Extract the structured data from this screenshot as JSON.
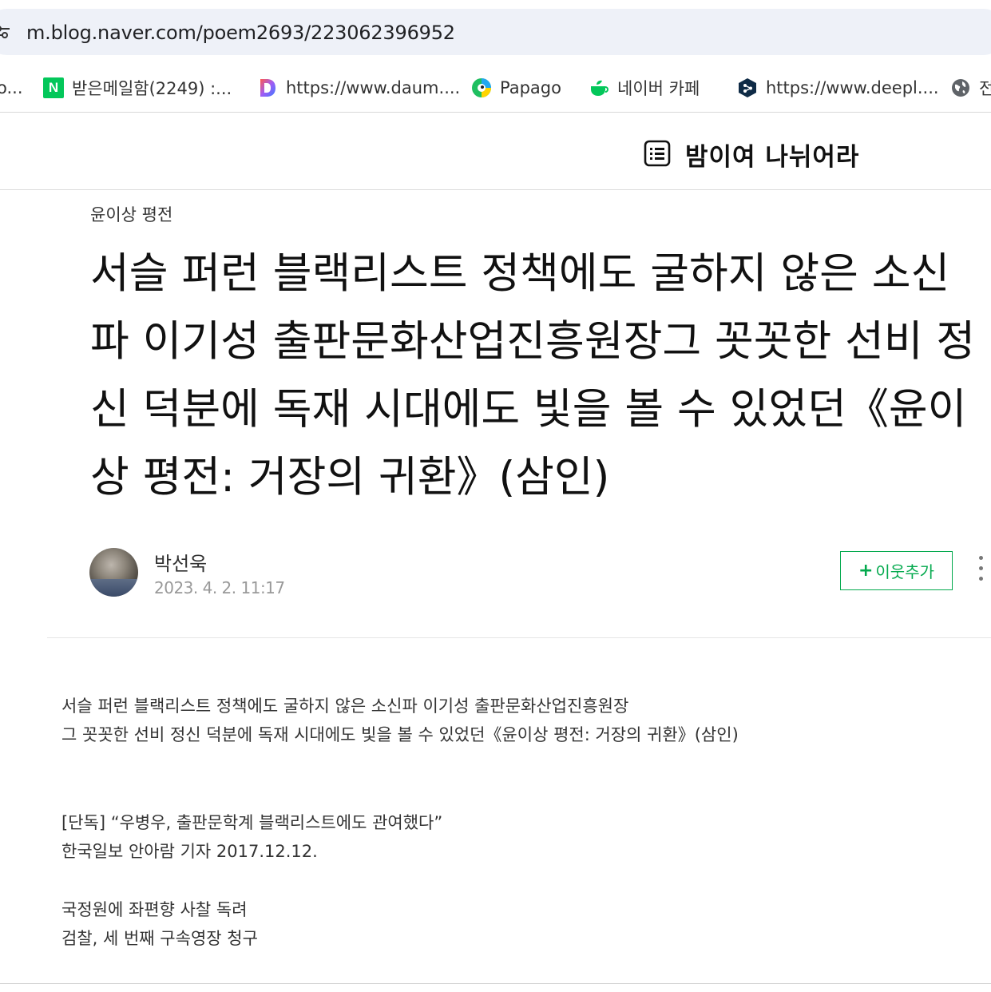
{
  "browser": {
    "url": "m.blog.naver.com/poem2693/223062396952",
    "bookmarks": [
      {
        "label": "o...",
        "icon": "unknown-icon"
      },
      {
        "label": "받은메일함(2249) :...",
        "icon": "naver-icon"
      },
      {
        "label": "https://www.daum....",
        "icon": "daum-icon"
      },
      {
        "label": "Papago",
        "icon": "papago-icon"
      },
      {
        "label": "네이버 카페",
        "icon": "naver-cafe-icon"
      },
      {
        "label": "https://www.deepl....",
        "icon": "deepl-icon"
      },
      {
        "label": "전",
        "icon": "globe-icon"
      }
    ]
  },
  "blog": {
    "title": "밤이여 나뉘어라"
  },
  "post": {
    "category": "윤이상 평전",
    "title": "서슬 퍼런 블랙리스트 정책에도 굴하지 않은 소신파 이기성 출판문화산업진흥원장그 꼿꼿한 선비 정신 덕분에 독재 시대에도 빛을 볼 수 있었던《윤이상 평전: 거장의 귀환》(삼인)",
    "author": "박선욱",
    "date": "2023. 4. 2. 11:17",
    "neighbor_plus": "+",
    "neighbor_label": "이웃추가"
  },
  "content": {
    "lines": [
      "서슬 퍼런 블랙리스트 정책에도 굴하지 않은 소신파 이기성 출판문화산업진흥원장",
      "그 꼿꼿한 선비 정신 덕분에 독재 시대에도 빛을 볼 수 있었던《윤이상 평전: 거장의 귀환》(삼인)",
      "[단독] “우병우, 출판문학계 블랙리스트에도 관여했다”",
      "한국일보 안아람 기자 2017.12.12.",
      "국정원에 좌편향 사찰 독려",
      "검찰, 세 번째 구속영장 청구"
    ]
  },
  "colors": {
    "accent_green": "#03a94d",
    "naver_green": "#03c75a",
    "address_bar": "#eef1f8"
  }
}
